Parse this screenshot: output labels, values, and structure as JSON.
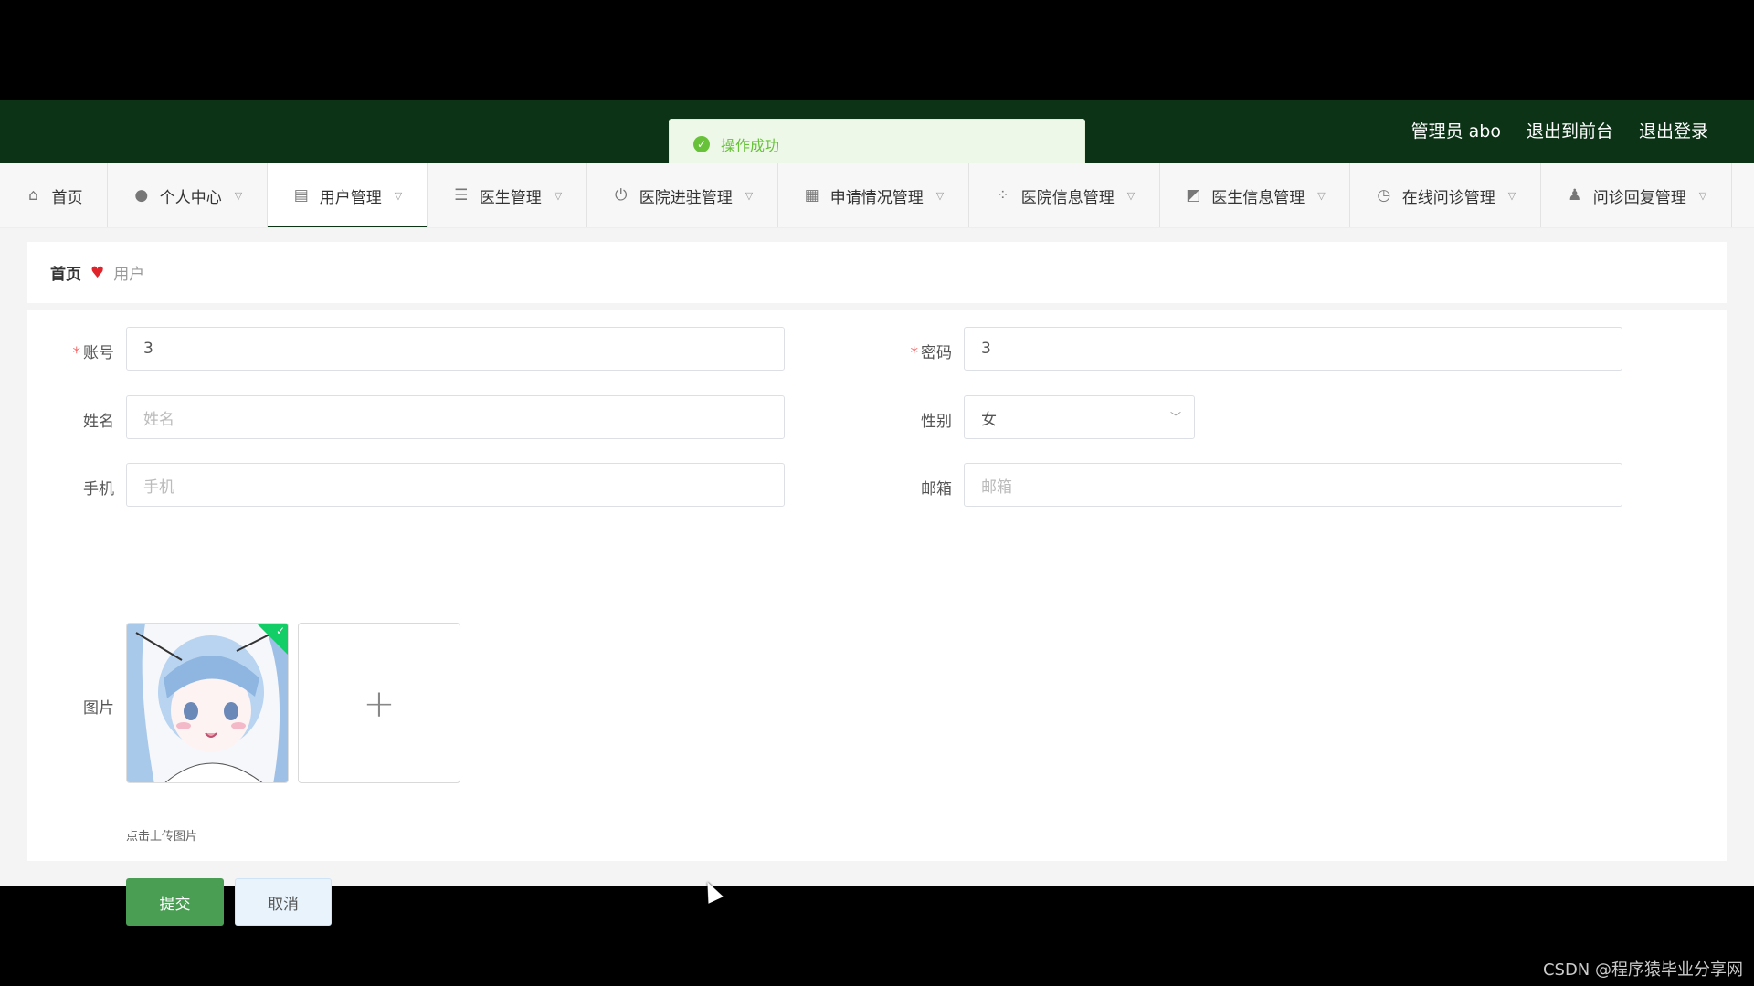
{
  "topbar": {
    "admin_label": "管理员 abo",
    "exit_front_label": "退出到前台",
    "logout_label": "退出登录"
  },
  "toast": {
    "message": "操作成功"
  },
  "nav": {
    "items": [
      {
        "label": "首页",
        "icon": "home-icon"
      },
      {
        "label": "个人中心",
        "icon": "user-icon"
      },
      {
        "label": "用户管理",
        "icon": "document-icon"
      },
      {
        "label": "医生管理",
        "icon": "list-icon"
      },
      {
        "label": "医院进驻管理",
        "icon": "power-icon"
      },
      {
        "label": "申请情况管理",
        "icon": "grid-icon"
      },
      {
        "label": "医院信息管理",
        "icon": "apps-icon"
      },
      {
        "label": "医生信息管理",
        "icon": "chart-icon"
      },
      {
        "label": "在线问诊管理",
        "icon": "clock-icon"
      },
      {
        "label": "问诊回复管理",
        "icon": "person-icon"
      }
    ]
  },
  "breadcrumb": {
    "home": "首页",
    "current": "用户"
  },
  "form": {
    "account_label": "账号",
    "account_value": "3",
    "password_label": "密码",
    "password_value": "3",
    "name_label": "姓名",
    "name_placeholder": "姓名",
    "gender_label": "性别",
    "gender_value": "女",
    "phone_label": "手机",
    "phone_placeholder": "手机",
    "email_label": "邮箱",
    "email_placeholder": "邮箱",
    "image_label": "图片",
    "upload_tip": "点击上传图片",
    "submit_label": "提交",
    "cancel_label": "取消"
  },
  "watermark": "CSDN @程序猿毕业分享网",
  "colors": {
    "header": "#0d3317",
    "accent": "#4a9e54",
    "success": "#67c23a"
  }
}
